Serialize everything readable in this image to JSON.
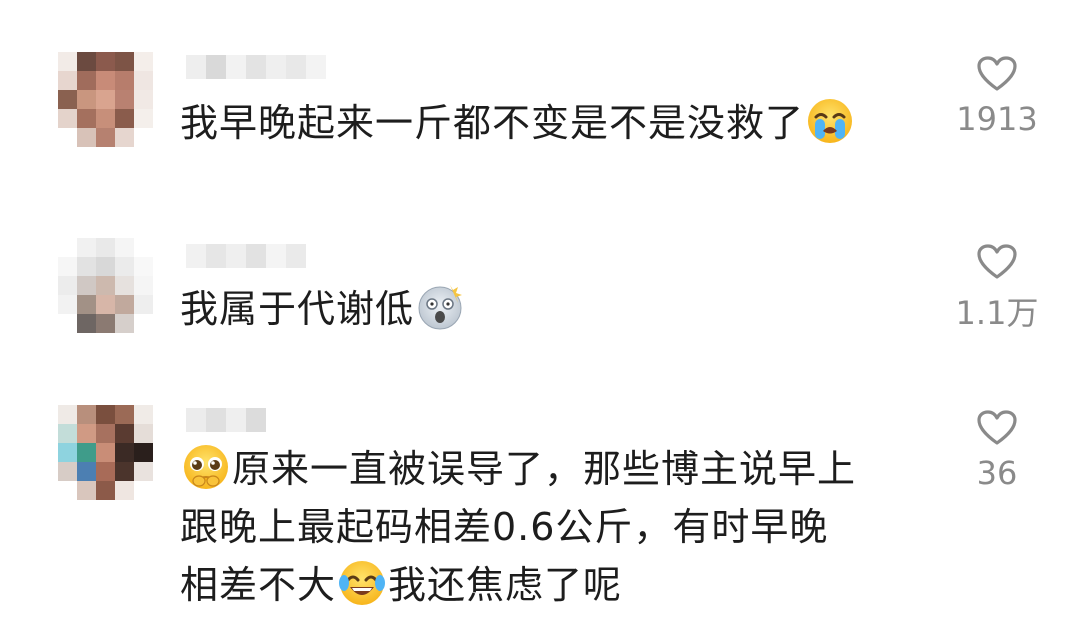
{
  "comments": [
    {
      "text_parts": [
        "我早晚起来一斤都不变是不是没救了",
        ""
      ],
      "emojis": [
        "loudly-crying-emoji"
      ],
      "likes": "1913"
    },
    {
      "text_parts": [
        "我属于代谢低",
        ""
      ],
      "emojis": [
        "shocked-face-emoji"
      ],
      "likes": "1.1万"
    },
    {
      "line1_after": "原来一直被误导了，那些博主说早上",
      "line2": "跟晚上最起码相差0.6公斤，有时早晚",
      "line3_before": "相差不大",
      "line3_after": "我还焦虑了呢",
      "emojis": [
        "pleading-face-emoji",
        "tears-of-joy-emoji"
      ],
      "likes": "36"
    }
  ],
  "icons": {
    "like": "heart-outline-icon"
  },
  "colors": {
    "text": "#1d1d1d",
    "count": "#8a8a8a",
    "heart": "#8a8a8a"
  }
}
